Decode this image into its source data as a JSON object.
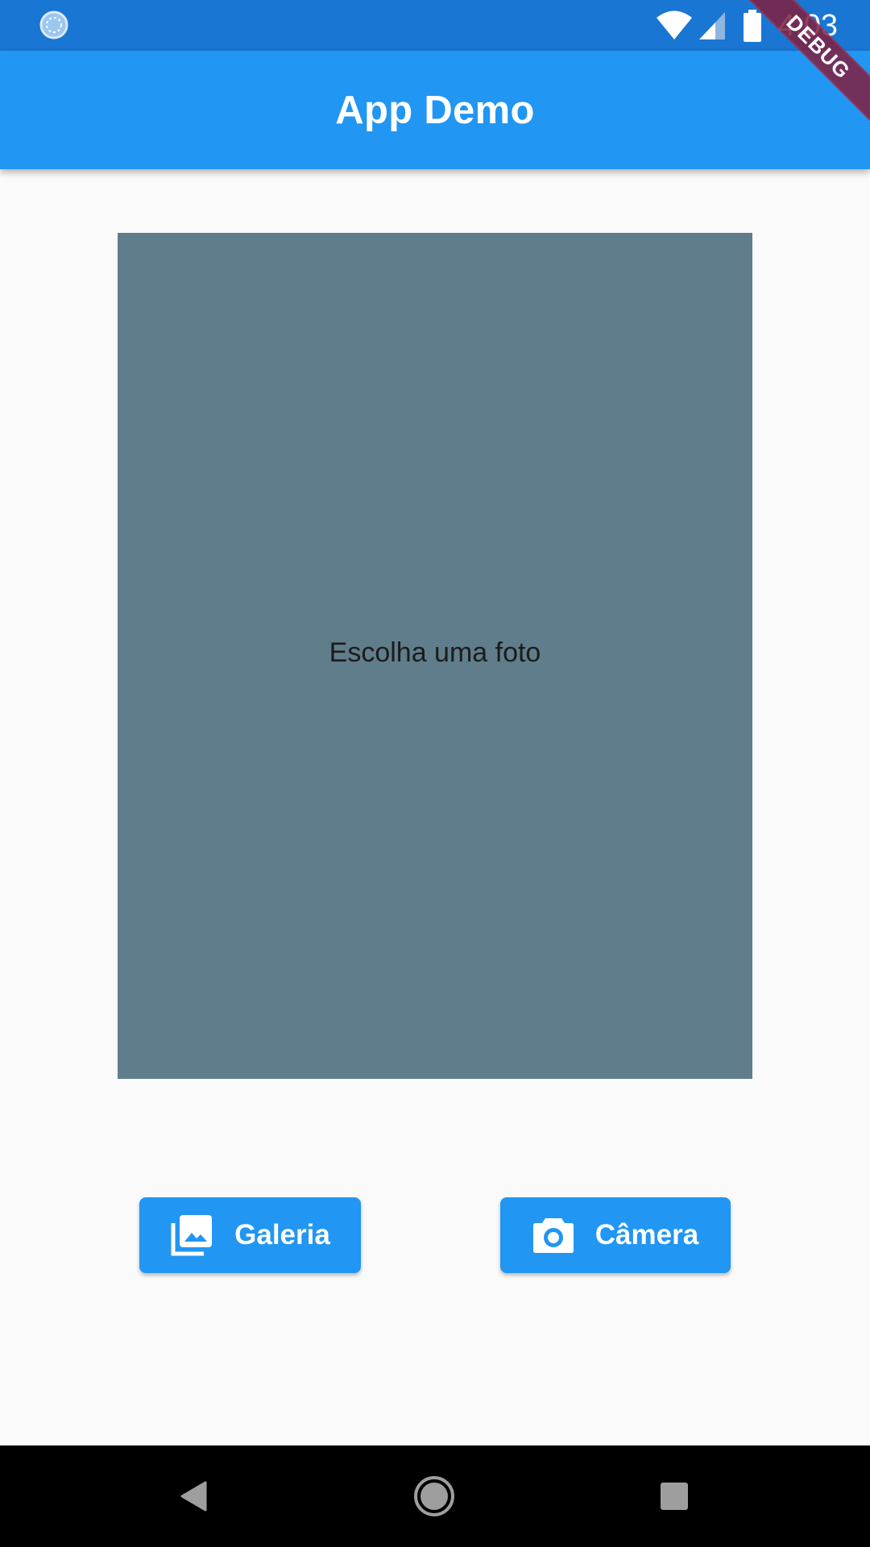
{
  "status_bar": {
    "time": "4:03",
    "icons": [
      "loading-icon",
      "wifi-icon",
      "signal-icon",
      "battery-icon"
    ]
  },
  "debug_banner": {
    "label": "DEBUG"
  },
  "app_bar": {
    "title": "App Demo"
  },
  "photo_placeholder": {
    "text": "Escolha uma foto"
  },
  "buttons": {
    "gallery": {
      "label": "Galeria",
      "icon": "photo-library-icon"
    },
    "camera": {
      "label": "Câmera",
      "icon": "camera-icon"
    }
  },
  "nav_bar": {
    "icons": [
      "back-icon",
      "home-icon",
      "recents-icon"
    ]
  },
  "colors": {
    "status_bar": "#1976d2",
    "primary": "#2196f3",
    "placeholder": "#607d8b",
    "background": "#fafafa",
    "debug_banner": "#802040"
  }
}
